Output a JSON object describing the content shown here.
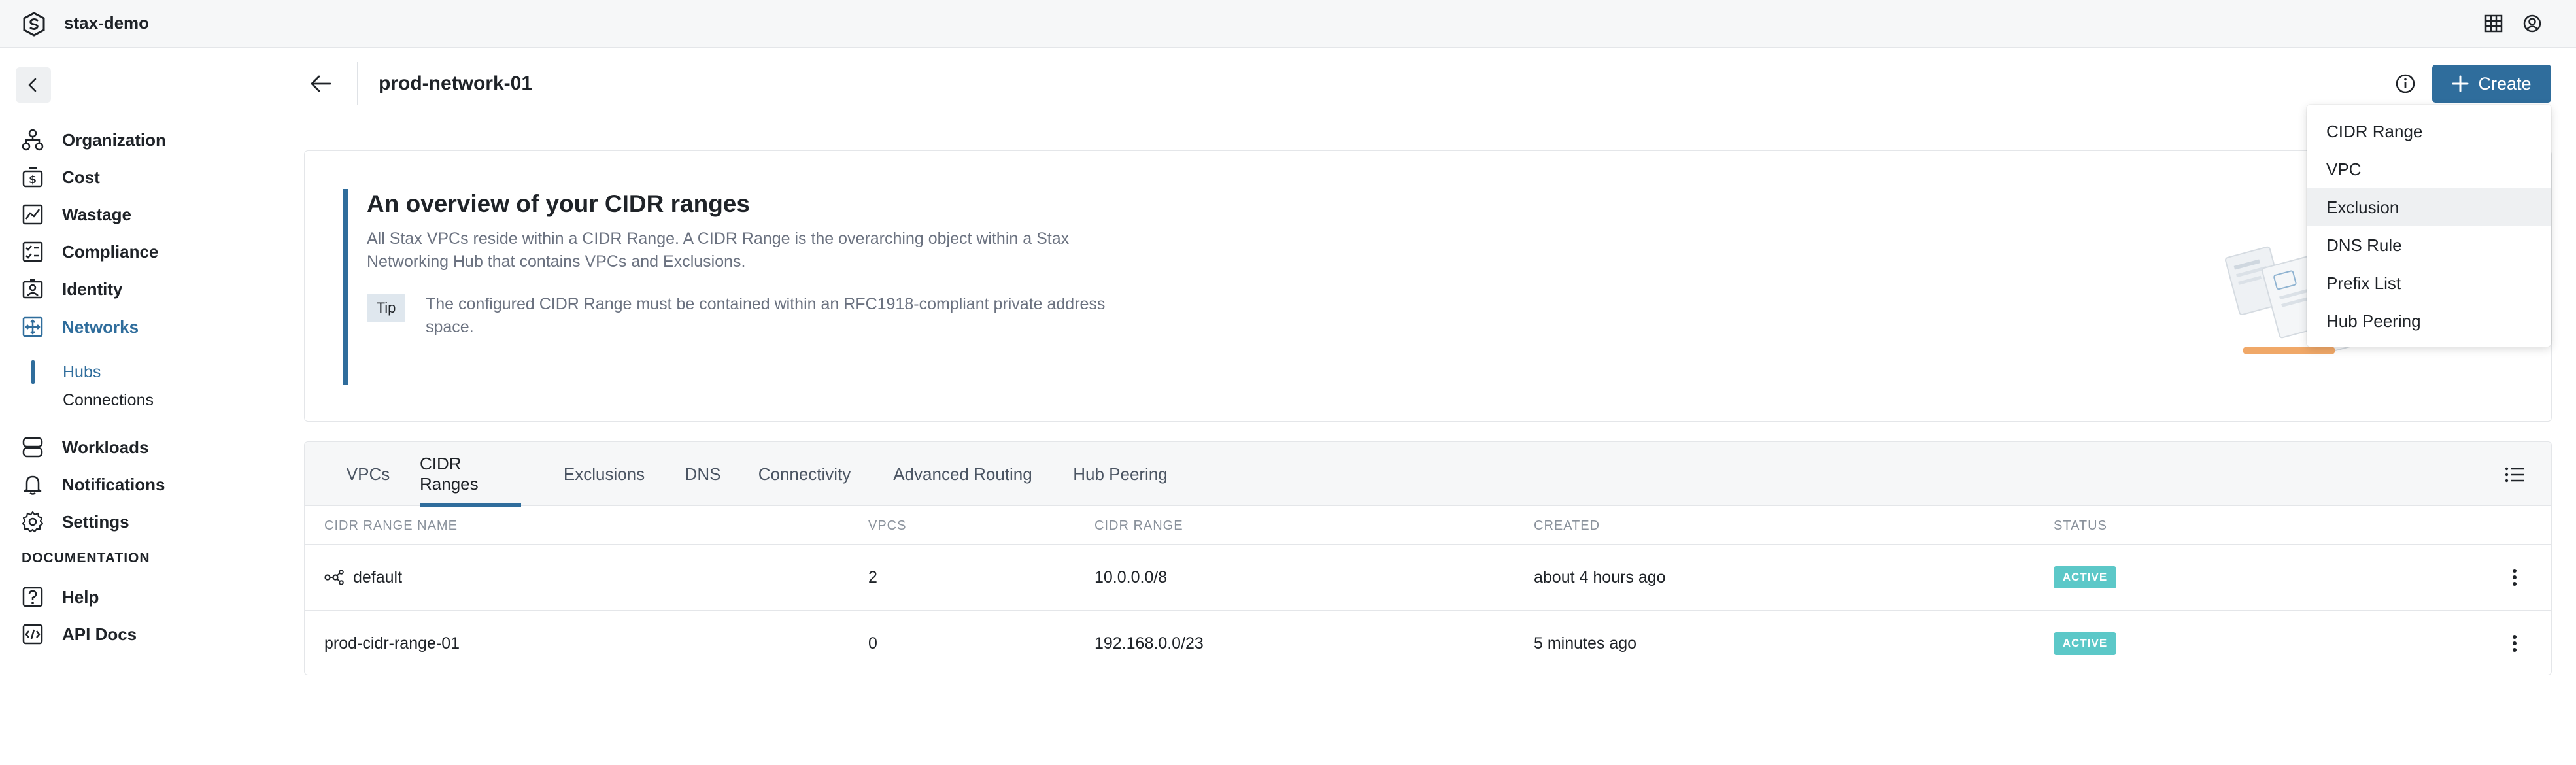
{
  "topbar": {
    "org_name": "stax-demo",
    "icons": [
      "stax-logo-icon",
      "grid-icon",
      "user-circle-icon"
    ]
  },
  "sidebar": {
    "items": [
      {
        "label": "Organization",
        "icon": "org-chart-icon"
      },
      {
        "label": "Cost",
        "icon": "dollar-icon"
      },
      {
        "label": "Wastage",
        "icon": "chart-icon"
      },
      {
        "label": "Compliance",
        "icon": "checklist-icon"
      },
      {
        "label": "Identity",
        "icon": "id-card-icon"
      },
      {
        "label": "Networks",
        "icon": "network-icon",
        "active": true
      },
      {
        "label": "Workloads",
        "icon": "stack-icon"
      },
      {
        "label": "Notifications",
        "icon": "bell-icon"
      },
      {
        "label": "Settings",
        "icon": "gear-icon"
      }
    ],
    "sub_items": [
      {
        "label": "Hubs",
        "active": true
      },
      {
        "label": "Connections"
      }
    ],
    "documentation_heading": "DOCUMENTATION",
    "doc_items": [
      {
        "label": "Help",
        "icon": "question-icon"
      },
      {
        "label": "API Docs",
        "icon": "api-icon"
      }
    ]
  },
  "header": {
    "title": "prod-network-01",
    "create_label": "Create"
  },
  "overview": {
    "title": "An overview of your CIDR ranges",
    "description": "All Stax VPCs reside within a CIDR Range. A CIDR Range is the overarching object within a Stax Networking Hub that contains VPCs and Exclusions.",
    "tip_label": "Tip",
    "tip_text": "The configured CIDR Range must be contained within an RFC1918-compliant private address space."
  },
  "tabs": [
    {
      "label": "VPCs"
    },
    {
      "label": "CIDR Ranges",
      "active": true
    },
    {
      "label": "Exclusions"
    },
    {
      "label": "DNS"
    },
    {
      "label": "Connectivity"
    },
    {
      "label": "Advanced Routing"
    },
    {
      "label": "Hub Peering"
    }
  ],
  "table": {
    "columns": [
      "CIDR RANGE NAME",
      "VPCS",
      "CIDR RANGE",
      "CREATED",
      "STATUS"
    ],
    "rows": [
      {
        "name": "default",
        "vpcs": "2",
        "cidr": "10.0.0.0/8",
        "created": "about 4 hours ago",
        "status": "ACTIVE",
        "icon": "hub-icon"
      },
      {
        "name": "prod-cidr-range-01",
        "vpcs": "0",
        "cidr": "192.168.0.0/23",
        "created": "5 minutes ago",
        "status": "ACTIVE"
      }
    ]
  },
  "create_menu": {
    "items": [
      "CIDR Range",
      "VPC",
      "Exclusion",
      "DNS Rule",
      "Prefix List",
      "Hub Peering"
    ],
    "hovered": "Exclusion"
  },
  "colors": {
    "accent": "#2f6d9c",
    "status_active": "#5cc8c8"
  }
}
